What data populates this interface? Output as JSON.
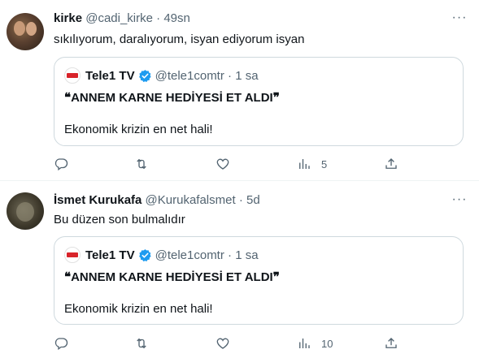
{
  "tweets": [
    {
      "name": "kirke",
      "handle": "@cadi_kirke",
      "separator": "·",
      "time": "49sn",
      "text": "sıkılıyorum, daralıyorum, isyan ediyorum isyan",
      "quote": {
        "name": "Tele1 TV",
        "handle": "@tele1comtr",
        "separator": "·",
        "time": "1 sa",
        "line1": "❝ANNEM KARNE HEDİYESİ ET ALDI❞",
        "line2": "Ekonomik krizin en net hali!"
      },
      "views": "5"
    },
    {
      "name": "İsmet Kurukafa",
      "handle": "@Kurukafalsmet",
      "separator": "·",
      "time": "5d",
      "text": "Bu düzen son bulmalıdır",
      "quote": {
        "name": "Tele1 TV",
        "handle": "@tele1comtr",
        "separator": "·",
        "time": "1 sa",
        "line1": "❝ANNEM KARNE HEDİYESİ ET ALDI❞",
        "line2": "Ekonomik krizin en net hali!"
      },
      "views": "10"
    }
  ],
  "more_label": "···",
  "colors": {
    "text": "#0f1419",
    "muted": "#536471",
    "verified": "#1d9bf0",
    "border": "#cfd9de"
  },
  "icons": [
    "more-icon",
    "reply-icon",
    "retweet-icon",
    "like-icon",
    "views-icon",
    "share-icon",
    "verified-icon"
  ]
}
